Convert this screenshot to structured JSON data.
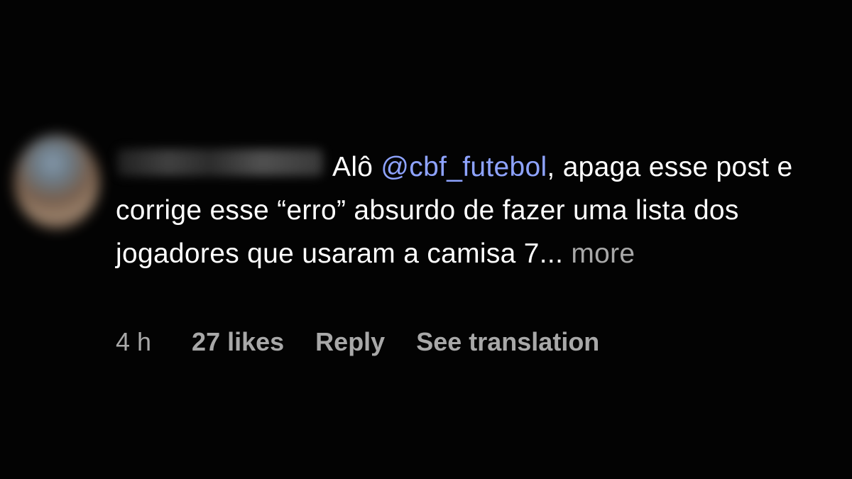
{
  "comment": {
    "avatar_icon": "user-avatar-blurred",
    "username_blurred": true,
    "text_start": "Alô ",
    "mention": "@cbf_futebol",
    "text_body": ", apaga esse post e corrige esse “erro” absurdo de fazer uma lista dos jogadores que usaram a camisa 7...",
    "more_label": " more",
    "time": "4 h",
    "likes": "27 likes",
    "reply_label": "Reply",
    "translate_label": "See translation"
  },
  "colors": {
    "background": "#030303",
    "text": "#ffffff",
    "mention": "#8ea3ff",
    "secondary": "#a8a8a8"
  }
}
